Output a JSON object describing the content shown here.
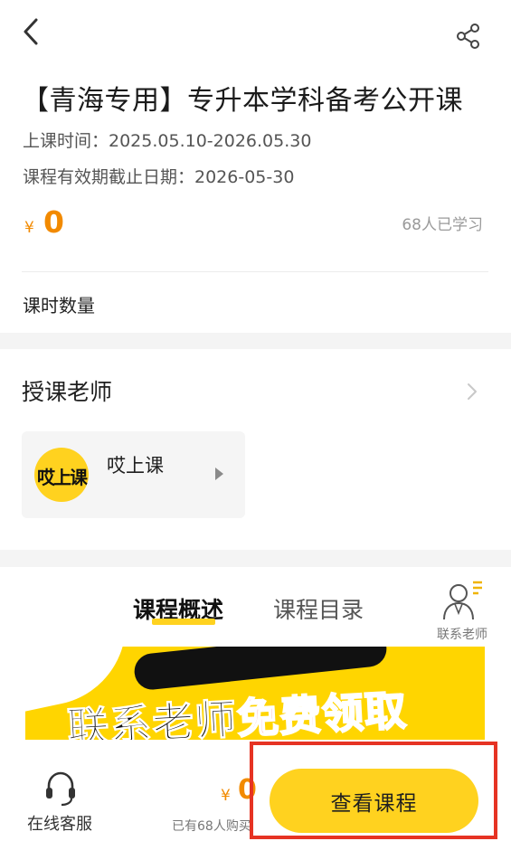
{
  "header": {
    "back_icon": "chevron-left-icon",
    "share_icon": "share-icon"
  },
  "course": {
    "title": "【青海专用】专升本学科备考公开课",
    "schedule": "上课时间：2025.05.10-2026.05.30",
    "expiry": "课程有效期截止日期：2026-05-30",
    "currency": "¥",
    "price": "0",
    "learners": "68人已学习",
    "hours_label": "课时数量"
  },
  "teacher_section": {
    "heading": "授课老师",
    "teacher": {
      "avatar_text": "哎上课",
      "name": "哎上课"
    }
  },
  "detail": {
    "tabs": [
      {
        "label": "课程概述",
        "active": true
      },
      {
        "label": "课程目录",
        "active": false
      }
    ],
    "contact_label": "联系老师",
    "banner_text_black": "联系老师",
    "banner_text_red": "免费领取"
  },
  "bottom_bar": {
    "service_label": "在线客服",
    "currency": "¥",
    "price": "0",
    "purchase_count": "已有68人购买",
    "view_course_label": "查看课程"
  },
  "colors": {
    "accent_yellow": "#ffd21f",
    "price_orange": "#f28a00",
    "highlight_red": "#e63323"
  }
}
